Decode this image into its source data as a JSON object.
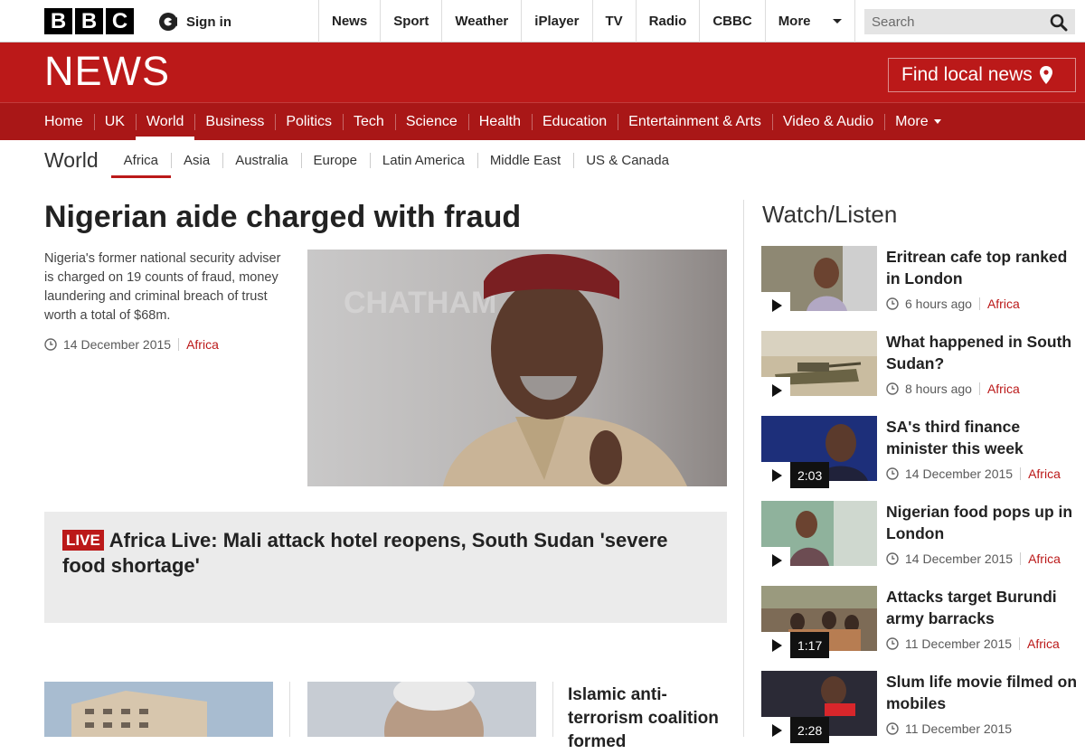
{
  "global": {
    "logo_letters": [
      "B",
      "B",
      "C"
    ],
    "sign_in": "Sign in",
    "nav": [
      "News",
      "Sport",
      "Weather",
      "iPlayer",
      "TV",
      "Radio",
      "CBBC",
      "More"
    ],
    "search_placeholder": "Search"
  },
  "news_header": {
    "title": "NEWS",
    "find_local": "Find local news"
  },
  "main_nav": {
    "items": [
      "Home",
      "UK",
      "World",
      "Business",
      "Politics",
      "Tech",
      "Science",
      "Health",
      "Education",
      "Entertainment & Arts",
      "Video & Audio",
      "More"
    ],
    "active": "World"
  },
  "sub_nav": {
    "title": "World",
    "items": [
      "Africa",
      "Asia",
      "Australia",
      "Europe",
      "Latin America",
      "Middle East",
      "US & Canada"
    ],
    "active": "Africa"
  },
  "top_story": {
    "headline": "Nigerian aide charged with fraud",
    "summary": "Nigeria's former national security adviser is charged on 19 counts of fraud, money laundering and criminal breach of trust worth a total of $68m.",
    "date": "14 December 2015",
    "tag": "Africa"
  },
  "live": {
    "badge": "LIVE",
    "text": "Africa Live: Mali attack hotel reopens, South Sudan 'severe food shortage'"
  },
  "story3": {
    "headline": "Islamic anti-terrorism coalition formed"
  },
  "watch_listen": {
    "title": "Watch/Listen",
    "videos": [
      {
        "title": "Eritrean cafe top ranked in London",
        "time": "6 hours ago",
        "tag": "Africa",
        "duration": ""
      },
      {
        "title": "What happened in South Sudan?",
        "time": "8 hours ago",
        "tag": "Africa",
        "duration": ""
      },
      {
        "title": "SA's third finance minister this week",
        "time": "14 December 2015",
        "tag": "Africa",
        "duration": "2:03"
      },
      {
        "title": "Nigerian food pops up in London",
        "time": "14 December 2015",
        "tag": "Africa",
        "duration": ""
      },
      {
        "title": "Attacks target Burundi army barracks",
        "time": "11 December 2015",
        "tag": "Africa",
        "duration": "1:17"
      },
      {
        "title": "Slum life movie filmed on mobiles",
        "time": "11 December 2015",
        "tag": "",
        "duration": "2:28"
      }
    ]
  },
  "colors": {
    "brand_red": "#bb1919",
    "nav_red": "#a91717",
    "live_box_bg": "#ebebeb"
  }
}
